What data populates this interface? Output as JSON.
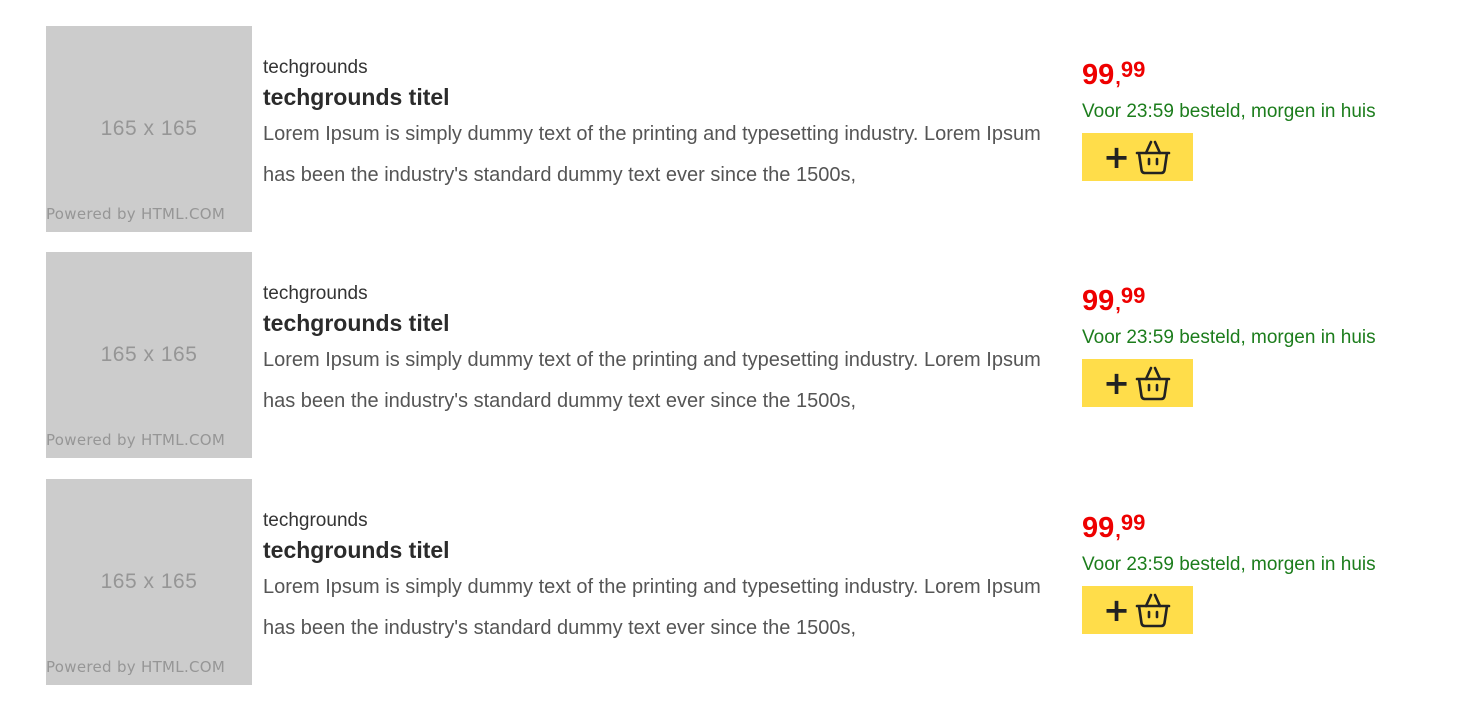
{
  "products": [
    {
      "image": {
        "size_label": "165 x 165",
        "watermark": "Powered by HTML.COM"
      },
      "brand": "techgrounds",
      "title": "techgrounds titel",
      "description": "Lorem Ipsum is simply dummy text of the printing and typesetting industry. Lorem Ipsum has been the industry's standard dummy text ever since the 1500s,",
      "price": {
        "whole": "99",
        "separator": ",",
        "fraction": "99"
      },
      "delivery": "Voor 23:59 besteld, morgen in huis",
      "cart_button": {
        "plus": "+",
        "icon": "basket-icon"
      }
    },
    {
      "image": {
        "size_label": "165 x 165",
        "watermark": "Powered by HTML.COM"
      },
      "brand": "techgrounds",
      "title": "techgrounds titel",
      "description": "Lorem Ipsum is simply dummy text of the printing and typesetting industry. Lorem Ipsum has been the industry's standard dummy text ever since the 1500s,",
      "price": {
        "whole": "99",
        "separator": ",",
        "fraction": "99"
      },
      "delivery": "Voor 23:59 besteld, morgen in huis",
      "cart_button": {
        "plus": "+",
        "icon": "basket-icon"
      }
    },
    {
      "image": {
        "size_label": "165 x 165",
        "watermark": "Powered by HTML.COM"
      },
      "brand": "techgrounds",
      "title": "techgrounds titel",
      "description": "Lorem Ipsum is simply dummy text of the printing and typesetting industry. Lorem Ipsum has been the industry's standard dummy text ever since the 1500s,",
      "price": {
        "whole": "99",
        "separator": ",",
        "fraction": "99"
      },
      "delivery": "Voor 23:59 besteld, morgen in huis",
      "cart_button": {
        "plus": "+",
        "icon": "basket-icon"
      }
    }
  ],
  "colors": {
    "price": "#ee0000",
    "delivery": "#1c7d1c",
    "cart_button": "#ffdd4a",
    "placeholder_bg": "#cccccc"
  }
}
